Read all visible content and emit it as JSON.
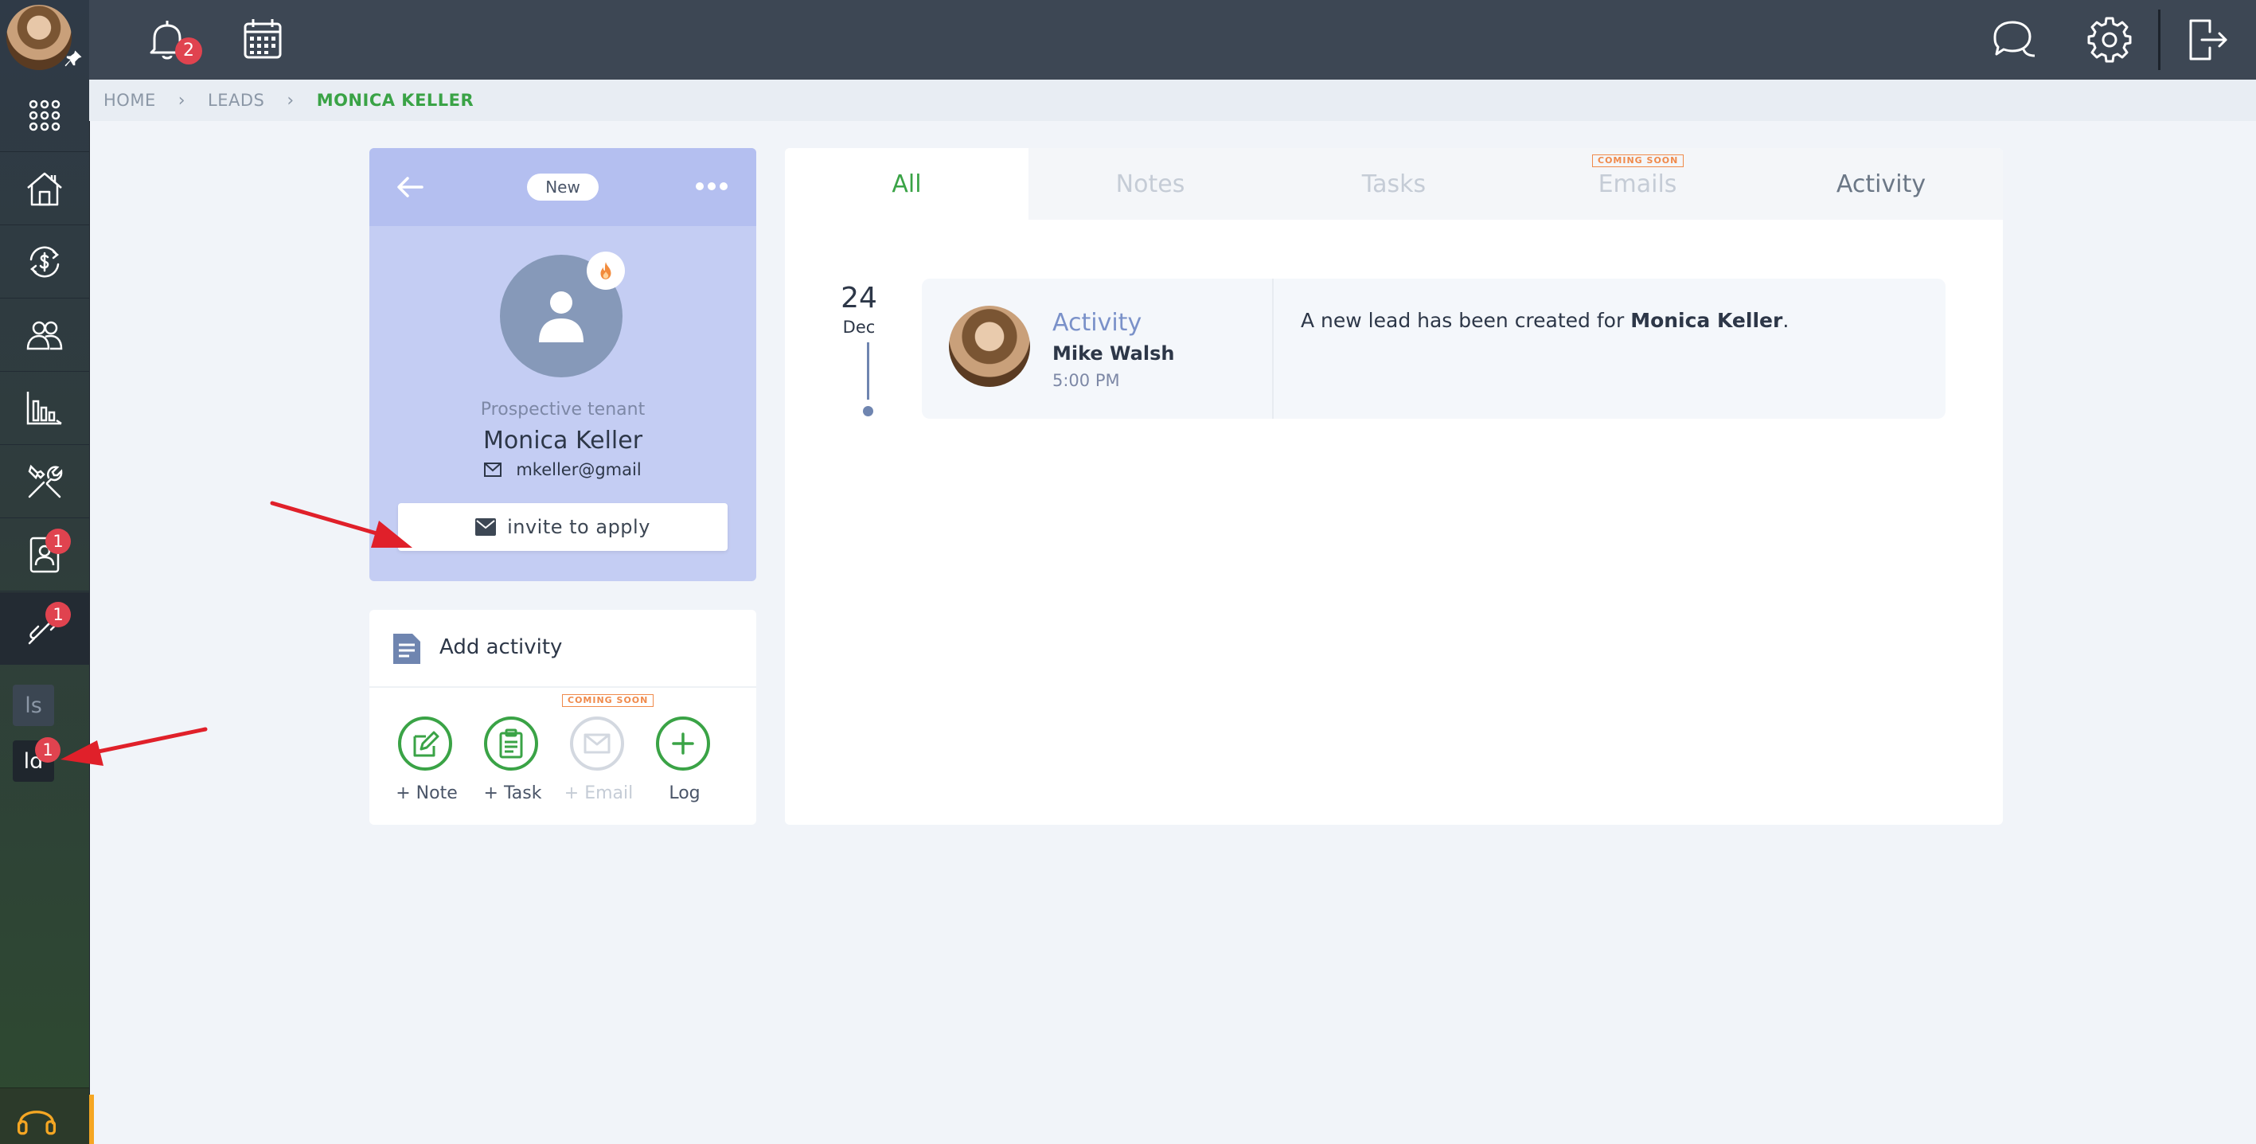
{
  "sidebar": {
    "items": [
      {
        "name": "apps-icon",
        "badge": ""
      },
      {
        "name": "properties-icon",
        "badge": ""
      },
      {
        "name": "accounting-icon",
        "badge": ""
      },
      {
        "name": "people-icon",
        "badge": ""
      },
      {
        "name": "reports-icon",
        "badge": ""
      },
      {
        "name": "maintenance-icon",
        "badge": ""
      },
      {
        "name": "leasing-icon",
        "badge": "1"
      },
      {
        "name": "leads-icon",
        "badge": "1"
      }
    ],
    "mini_items": [
      {
        "label": "ls",
        "badge": ""
      },
      {
        "label": "ld",
        "badge": "1"
      }
    ]
  },
  "topbar": {
    "notifications_badge": "2"
  },
  "breadcrumb": {
    "home": "HOME",
    "leads": "LEADS",
    "current": "MONICA KELLER"
  },
  "lead": {
    "status": "New",
    "role": "Prospective tenant",
    "name": "Monica Keller",
    "email": "mkeller@gmail",
    "invite_label": "invite to apply"
  },
  "add_activity": {
    "title": "Add activity",
    "coming_soon": "COMING SOON",
    "buttons": [
      {
        "label": "+ Note"
      },
      {
        "label": "+ Task"
      },
      {
        "label": "+ Email"
      },
      {
        "label": "Log"
      }
    ]
  },
  "tabs": [
    {
      "label": "All"
    },
    {
      "label": "Notes"
    },
    {
      "label": "Tasks"
    },
    {
      "label": "Emails",
      "tag": "COMING SOON"
    },
    {
      "label": "Activity"
    }
  ],
  "timeline": {
    "day": "24",
    "month": "Dec",
    "entry": {
      "type": "Activity",
      "author": "Mike Walsh",
      "time": "5:00 PM",
      "message_prefix": "A new lead has been created for ",
      "message_name": "Monica Keller",
      "message_suffix": "."
    }
  },
  "colors": {
    "accent_green": "#3aa346",
    "badge_red": "#e0434f",
    "card_lavender": "#c4cdf3",
    "annotation_arrow": "#e0202a"
  }
}
